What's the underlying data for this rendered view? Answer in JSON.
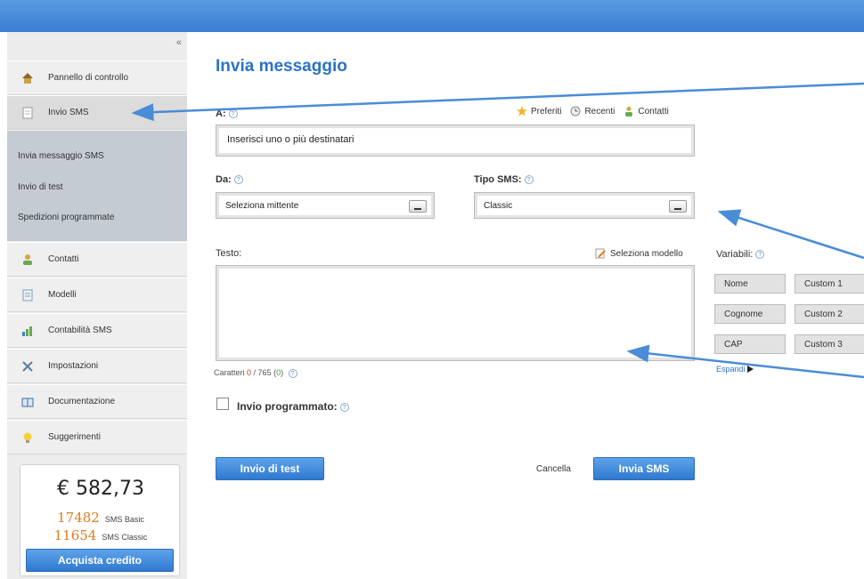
{
  "sidebar": {
    "collapse": "«",
    "items": [
      {
        "label": "Pannello di controllo",
        "icon": "home-icon"
      },
      {
        "label": "Invio SMS",
        "icon": "sms-icon"
      },
      {
        "label": "Contatti",
        "icon": "contacts-icon"
      },
      {
        "label": "Modelli",
        "icon": "templates-icon"
      },
      {
        "label": "Contabilità SMS",
        "icon": "chart-icon"
      },
      {
        "label": "Impostazioni",
        "icon": "settings-icon"
      },
      {
        "label": "Documentazione",
        "icon": "book-icon"
      },
      {
        "label": "Suggerimenti",
        "icon": "bulb-icon"
      }
    ],
    "sub_items": [
      {
        "label": "Invia messaggio SMS"
      },
      {
        "label": "Invio di test"
      },
      {
        "label": "Spedizioni programmate"
      }
    ],
    "credit": {
      "amount": "€ 582,73",
      "basic_count": "17482",
      "basic_label": "SMS Basic",
      "classic_count": "11654",
      "classic_label": "SMS Classic",
      "buy_label": "Acquista credito"
    }
  },
  "main": {
    "title": "Invia messaggio",
    "to_label": "A:",
    "to_placeholder": "Inserisci uno o più destinatari",
    "quick_links": {
      "favorites": "Preferiti",
      "recent": "Recenti",
      "contacts": "Contatti"
    },
    "from_label": "Da:",
    "from_value": "Seleziona mittente",
    "type_label": "Tipo SMS:",
    "type_value": "Classic",
    "text_label": "Testo:",
    "select_template": "Seleziona modello",
    "counter_prefix": "Caratteri",
    "counter_chars": "0",
    "counter_sep": " / 765 (",
    "counter_sms": "0",
    "counter_suffix": ")",
    "variables_label": "Variabili:",
    "variables": [
      "Nome",
      "Custom 1",
      "Cognome",
      "Custom 2",
      "CAP",
      "Custom 3"
    ],
    "expand_label": "Espandi",
    "scheduled_label": "Invio programmato:",
    "test_button": "Invio di test",
    "cancel_label": "Cancella",
    "send_button": "Invia SMS"
  },
  "colors": {
    "accent": "#2b73c4",
    "orange": "#e07b1f",
    "topbar": "#4a8cdb",
    "arrow": "#4a8cd6"
  }
}
